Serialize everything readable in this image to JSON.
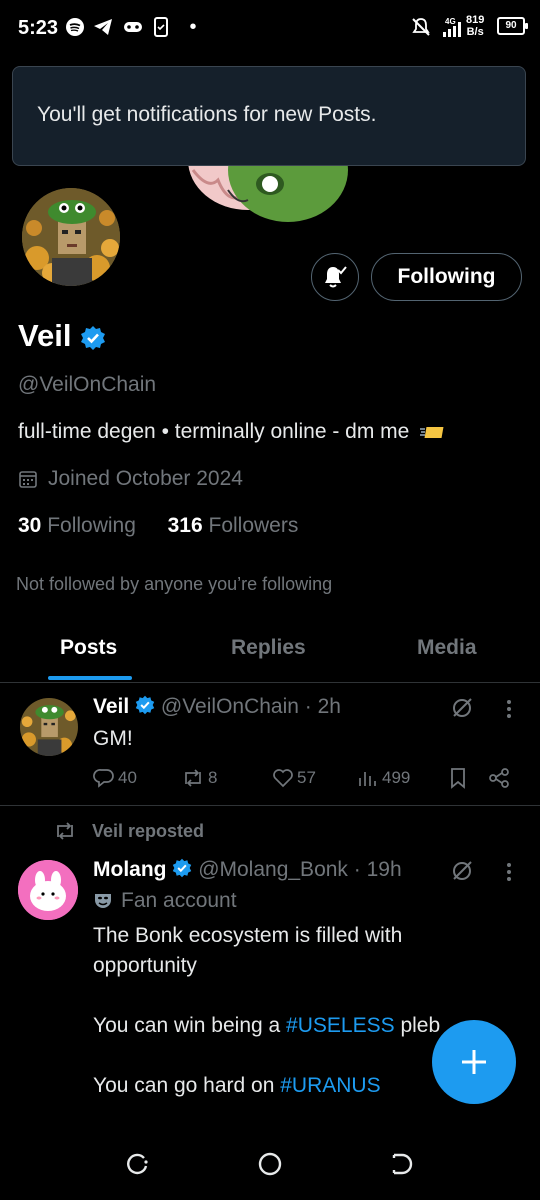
{
  "status_bar": {
    "time": "5:23",
    "net_speed_value": "819",
    "net_speed_unit": "B/s",
    "network_type": "4G",
    "battery": "90"
  },
  "toast": {
    "text": "You'll get notifications for new Posts."
  },
  "profile": {
    "name": "Veil",
    "handle": "@VeilOnChain",
    "bio": "full-time degen • terminally online - dm me",
    "joined": "Joined October 2024",
    "following_count": "30",
    "following_label": "Following",
    "followers_count": "316",
    "followers_label": "Followers",
    "not_followed": "Not followed by anyone you’re following",
    "follow_button": "Following"
  },
  "tabs": [
    {
      "label": "Posts",
      "active": true
    },
    {
      "label": "Replies",
      "active": false
    },
    {
      "label": "Media",
      "active": false
    }
  ],
  "post1": {
    "name": "Veil",
    "handle_time": "@VeilOnChain · 2h",
    "text": "GM!",
    "replies": "40",
    "reposts": "8",
    "likes": "57",
    "views": "499"
  },
  "post2": {
    "repost_label": "Veil reposted",
    "name": "Molang",
    "handle_time": "@Molang_Bonk · 19h",
    "label": "Fan account",
    "line1": "The Bonk ecosystem is filled with",
    "line2": "opportunity",
    "line3_pre": "You can win being a ",
    "line3_tag": "#USELESS",
    "line3_post": " pleb",
    "line4_pre": "You can go hard on ",
    "line4_tag": "#URANUS"
  },
  "colors": {
    "accent": "#1d9bf0",
    "muted": "#71767b",
    "toast_bg": "#15202b"
  }
}
